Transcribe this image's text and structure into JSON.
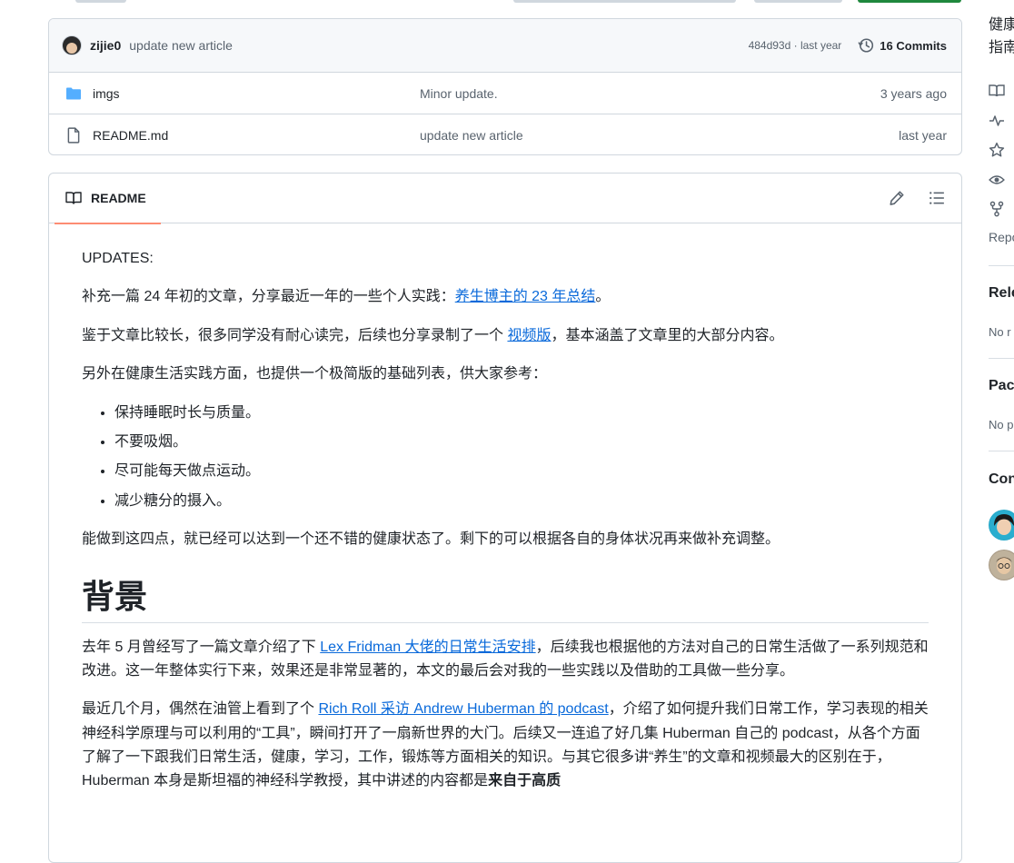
{
  "commit": {
    "author": "zijie0",
    "message": "update new article",
    "hash_time": "484d93d · last year",
    "commits_label": "16 Commits"
  },
  "files": [
    {
      "icon": "folder-icon",
      "name": "imgs",
      "message": "Minor update.",
      "time": "3 years ago"
    },
    {
      "icon": "file-icon",
      "name": "README.md",
      "message": "update new article",
      "time": "last year"
    }
  ],
  "readme": {
    "tab_label": "README",
    "updates": "UPDATES:",
    "p1_pre": "补充一篇 24 年初的文章，分享最近一年的一些个人实践：",
    "p1_link": "养生博主的 23 年总结",
    "p1_post": "。",
    "p2_pre": "鉴于文章比较长，很多同学没有耐心读完，后续也分享录制了一个 ",
    "p2_link": "视频版",
    "p2_post": "，基本涵盖了文章里的大部分内容。",
    "p3": "另外在健康生活实践方面，也提供一个极简版的基础列表，供大家参考：",
    "list": [
      "保持睡眠时长与质量。",
      "不要吸烟。",
      "尽可能每天做点运动。",
      "减少糖分的摄入。"
    ],
    "p4": "能做到这四点，就已经可以达到一个还不错的健康状态了。剩下的可以根据各自的身体状况再来做补充调整。",
    "h1": "背景",
    "p5_pre": "去年 5 月曾经写了一篇文章介绍了下 ",
    "p5_link": "Lex Fridman 大佬的日常生活安排",
    "p5_post": "，后续我也根据他的方法对自己的日常生活做了一系列规范和改进。这一年整体实行下来，效果还是非常显著的，本文的最后会对我的一些实践以及借助的工具做一些分享。",
    "p6_pre": "最近几个月，偶然在油管上看到了个 ",
    "p6_link": "Rich Roll 采访 Andrew Huberman 的 podcast",
    "p6_mid": "，介绍了如何提升我们日常工作，学习表现的相关神经科学原理与可以利用的“工具”，瞬间打开了一扇新世界的大门。后续又一连追了好几集 Huberman 自己的 podcast，从各个方面了解了一下跟我们日常生活，健康，学习，工作，锻炼等方面相关的知识。与其它很多讲“养生”的文章和视频最大的区别在于，Huberman 本身是斯坦福的神经科学教授，其中讲述的内容都是",
    "p6_bold": "来自于高质"
  },
  "sidebar": {
    "about_line1": "健康",
    "about_line2": "指南",
    "repo_label": "Repo",
    "releases_head": "Rele",
    "releases_text": "No r",
    "packages_head": "Pac",
    "packages_text": "No p",
    "contributors_head": "Con"
  }
}
